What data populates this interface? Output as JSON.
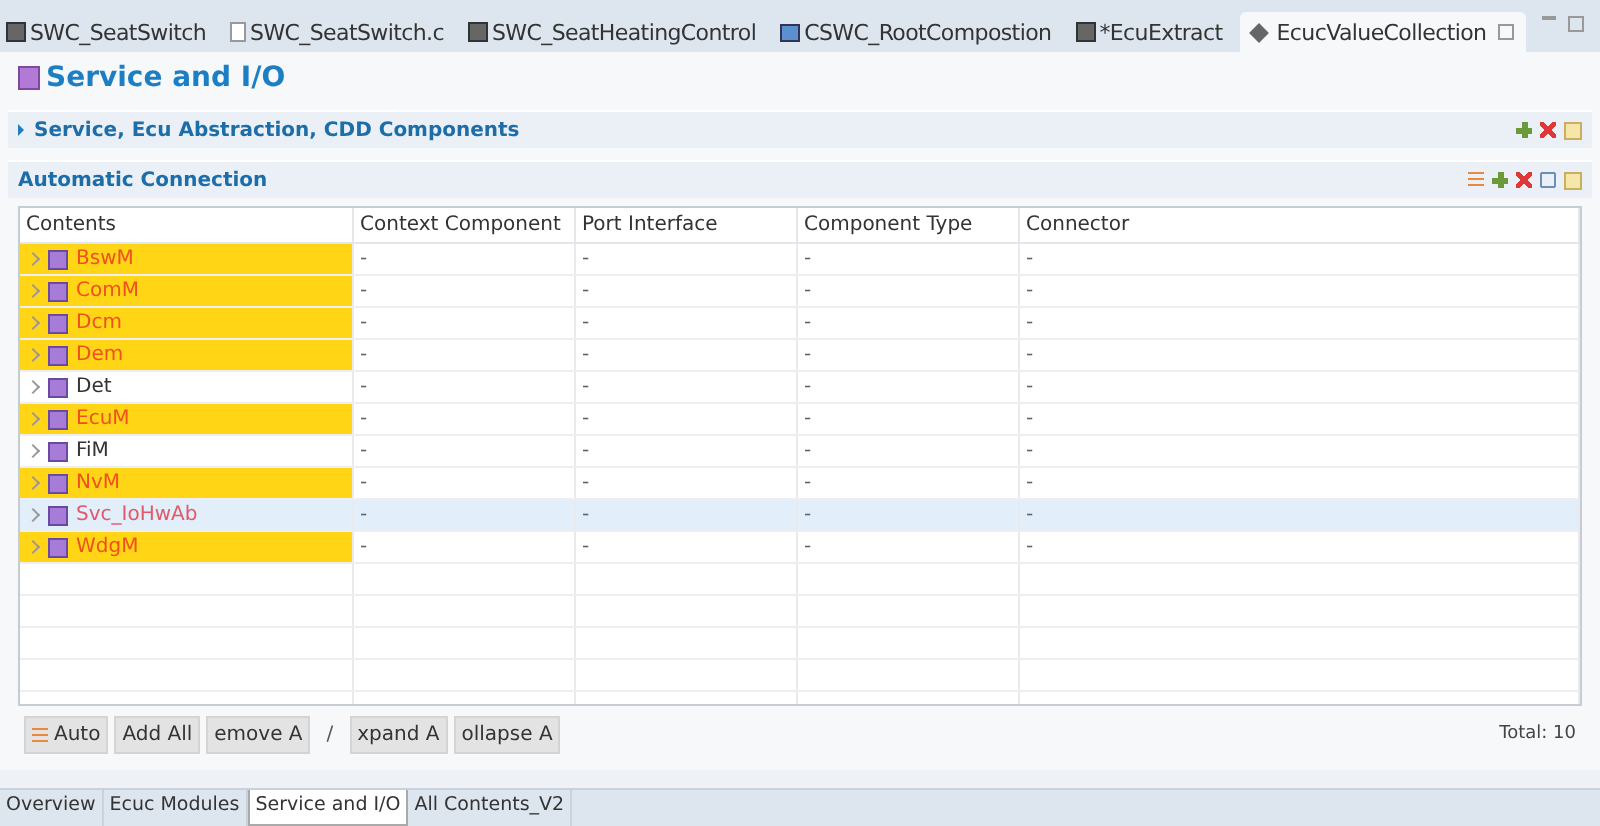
{
  "editor_tabs": [
    {
      "label": "SWC_SeatSwitch",
      "kind": "component",
      "selected": false
    },
    {
      "label": "SWC_SeatSwitch.c",
      "kind": "file",
      "selected": false
    },
    {
      "label": "SWC_SeatHeatingControl",
      "kind": "component",
      "selected": false
    },
    {
      "label": "CSWC_RootCompostion",
      "kind": "composition",
      "selected": false
    },
    {
      "label": "*EcuExtract",
      "kind": "component",
      "selected": false
    },
    {
      "label": "EcucValueCollection",
      "kind": "collection",
      "selected": true
    }
  ],
  "page_title": "Service and I/O",
  "sections": [
    {
      "title": "Service, Ecu Abstraction, CDD Components",
      "kind": "collapsed"
    },
    {
      "title": "Automatic Connection",
      "kind": "open"
    }
  ],
  "table": {
    "columns": [
      "Contents",
      "Context Component",
      "Port Interface",
      "Component Type",
      "Connector"
    ],
    "rows": [
      {
        "cells": [
          "BswM",
          "-",
          "-",
          "-",
          "-"
        ],
        "highlighted": true,
        "selected": false
      },
      {
        "cells": [
          "ComM",
          "-",
          "-",
          "-",
          "-"
        ],
        "highlighted": true,
        "selected": false
      },
      {
        "cells": [
          "Dcm",
          "-",
          "-",
          "-",
          "-"
        ],
        "highlighted": true,
        "selected": false
      },
      {
        "cells": [
          "Dem",
          "-",
          "-",
          "-",
          "-"
        ],
        "highlighted": true,
        "selected": false
      },
      {
        "cells": [
          "Det",
          "-",
          "-",
          "-",
          "-"
        ],
        "highlighted": false,
        "selected": false
      },
      {
        "cells": [
          "EcuM",
          "-",
          "-",
          "-",
          "-"
        ],
        "highlighted": true,
        "selected": false
      },
      {
        "cells": [
          "FiM",
          "-",
          "-",
          "-",
          "-"
        ],
        "highlighted": false,
        "selected": false
      },
      {
        "cells": [
          "NvM",
          "-",
          "-",
          "-",
          "-"
        ],
        "highlighted": true,
        "selected": false
      },
      {
        "cells": [
          "Svc_IoHwAb",
          "-",
          "-",
          "-",
          "-"
        ],
        "highlighted": false,
        "selected": true
      },
      {
        "cells": [
          "WdgM",
          "-",
          "-",
          "-",
          "-"
        ],
        "highlighted": true,
        "selected": false
      }
    ]
  },
  "actions": [
    {
      "kind": "button",
      "label": "Auto",
      "icon": true
    },
    {
      "kind": "button",
      "label": "Add All"
    },
    {
      "kind": "button",
      "label": "emove A"
    },
    {
      "kind": "text",
      "label": "/"
    },
    {
      "kind": "button",
      "label": "xpand A"
    },
    {
      "kind": "button",
      "label": "ollapse A"
    }
  ],
  "total": "Total: 10",
  "page_tabs": [
    {
      "label": "Overview",
      "selected": false
    },
    {
      "label": "Ecuc Modules",
      "selected": false
    },
    {
      "label": "Service and I/O",
      "selected": true
    },
    {
      "label": "All Contents_V2",
      "selected": false
    }
  ]
}
